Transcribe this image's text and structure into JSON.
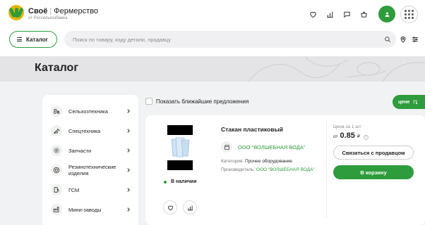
{
  "header": {
    "brand": "Своё",
    "brand_sub": "Фермерство",
    "tagline": "от Россельхозбанка",
    "icons": [
      "heart-icon",
      "compare-icon",
      "chat-icon",
      "basket-icon",
      "user-icon",
      "apps-icon"
    ]
  },
  "search": {
    "catalog_label": "Каталог",
    "placeholder": "Поиск по товару, коду детали, продавцу"
  },
  "page": {
    "title": "Каталог"
  },
  "sidebar": {
    "items": [
      {
        "label": "Сельхозтехника",
        "icon": "tractor-icon"
      },
      {
        "label": "Спецтехника",
        "icon": "excavator-icon"
      },
      {
        "label": "Запчасти",
        "icon": "gear-icon"
      },
      {
        "label": "Резинотехнические изделия",
        "icon": "tire-icon"
      },
      {
        "label": "ГСМ",
        "icon": "fuel-icon"
      },
      {
        "label": "Мини-заводы",
        "icon": "factory-icon"
      }
    ]
  },
  "filters": {
    "nearby_label": "Показать ближайшие предложения",
    "sort_label": "цене"
  },
  "product": {
    "title": "Стакан пластиковый",
    "seller": "ООО \"ВОЛШЕБНАЯ ВОДА\"",
    "category_label": "Категория:",
    "category_value": "Прочее оборудование",
    "producer_label": "Производитель:",
    "producer_value": "ООО \"ВОЛШЕБНАЯ ВОДА\"",
    "stock": "В наличии",
    "price_caption": "Цена за 1 шт",
    "price_prefix": "от",
    "price_value": "0.85",
    "currency": "₽",
    "contact_label": "Связаться с продавцом",
    "cart_label": "В корзину"
  },
  "colors": {
    "accent": "#2e9c3c",
    "background": "#f1f2f4",
    "card": "#ffffff"
  }
}
